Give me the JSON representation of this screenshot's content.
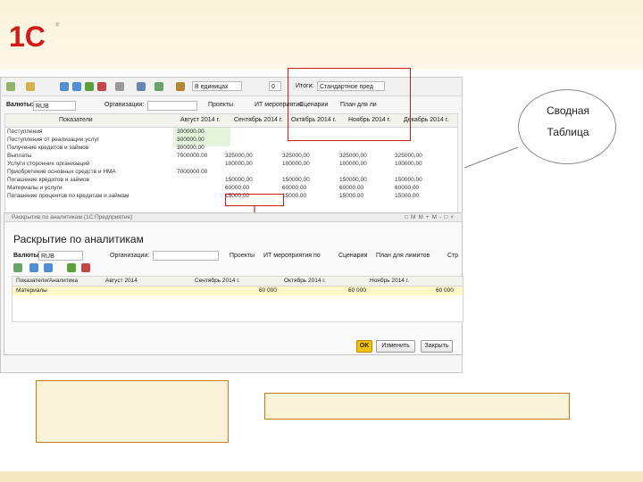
{
  "colors": {
    "accent_red": "#d31919",
    "highlight_yellow": "#fff7c6",
    "green_col": "#e3f3dc",
    "ok_button": "#f2c100",
    "bubble_border": "#8a8a8a",
    "callout_border": "#c77a1a"
  },
  "logo": {
    "text": "1С",
    "mark": "®",
    "icon": "1c-logo"
  },
  "main": {
    "toolbar": {
      "icons": [
        "refresh-icon",
        "folder-icon",
        "arrow-up-icon",
        "arrow-down-icon",
        "add-icon",
        "delete-icon",
        "copy-icon",
        "settings-icon",
        "table-icon",
        "chart-icon"
      ],
      "units_value": "В единицах",
      "decimals_value": "0",
      "totals_label": "Итоги:",
      "totals_value": "Стандартное пред"
    },
    "filters": {
      "currency_label": "Валюты:",
      "currency_value": "RUB",
      "org_label": "Организации:",
      "project_label": "Проекты",
      "it_label": "ИТ мероприятия",
      "scenario_label": "Сценарии",
      "plan_label": "План для ли"
    },
    "table": {
      "headers": [
        "Показатели",
        "Август 2014 г.",
        "Сентябрь 2014 г.",
        "Октябрь 2014 г.",
        "Ноябрь 2014 г.",
        "Декабрь 2014 г."
      ],
      "rows": [
        {
          "name": "Поступления",
          "values": [
            "300000.00",
            "",
            "",
            "",
            ""
          ]
        },
        {
          "name": "Поступления от реализации услуг",
          "values": [
            "300000.00",
            "",
            "",
            "",
            ""
          ]
        },
        {
          "name": "Получение кредитов и займов",
          "values": [
            "300000.00",
            "",
            "",
            "",
            ""
          ]
        },
        {
          "name": "Выплаты",
          "values": [
            "7000000.00",
            "325000,00",
            "325000,00",
            "325000,00",
            "325000,00"
          ]
        },
        {
          "name": "Услуги сторонних организаций",
          "values": [
            "",
            "100000,00",
            "100000,00",
            "100000,00",
            "100000,00"
          ]
        },
        {
          "name": "Приобретение основных средств и НМА",
          "values": [
            "7000000.00",
            "",
            "",
            "",
            ""
          ]
        },
        {
          "name": "Погашение кредитов и займов",
          "values": [
            "",
            "150000,00",
            "150000,00",
            "150000,00",
            "150000,00"
          ]
        },
        {
          "name": "Материалы и услуги",
          "values": [
            "",
            "60000,00",
            "60000,00",
            "60000,00",
            "60000,00"
          ]
        },
        {
          "name": "Погашение процентов по кредитам и займам",
          "values": [
            "",
            "15000,00",
            "15000,00",
            "15000,00",
            "15000,00"
          ]
        }
      ]
    }
  },
  "dialog": {
    "title": "Раскрытие по аналитикам (1С:Предприятие)",
    "window_controls": [
      "□",
      "M",
      "M+",
      "M-",
      "□",
      "×"
    ],
    "heading": "Раскрытие по аналитикам",
    "filters": {
      "currency_label": "Валюты:",
      "currency_value": "RUB",
      "org_label": "Организации:",
      "project_label": "Проекты",
      "it_label": "ИТ мероприятия по",
      "scenario_label": "Сценарии",
      "plan_label": "План для лимитов",
      "extra_label": "Стр"
    },
    "icons": [
      "refresh-icon",
      "sort-asc-icon",
      "sort-desc-icon",
      "add-row-icon",
      "delete-row-icon"
    ],
    "table": {
      "headers": [
        "Показатели/Аналитика",
        "Август 2014",
        "Сентябрь 2014 г.",
        "Октябрь 2014 г.",
        "Ноябрь 2014 г."
      ],
      "row": {
        "name": "Материалы",
        "values": [
          "",
          "60 000",
          "60 000",
          "60 000",
          "60 000"
        ]
      }
    },
    "ok_label": "OK",
    "change_label": "Изменить",
    "close_label": "Закрыть"
  },
  "callout": {
    "line1": "Сводная",
    "line2": "Таблица"
  }
}
